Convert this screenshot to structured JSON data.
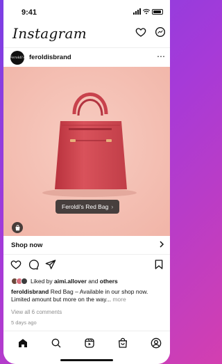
{
  "status": {
    "time": "9:41"
  },
  "header": {
    "logo": "Instagram"
  },
  "post": {
    "account": "feroldisbrand",
    "avatar_text": "Feroldi's",
    "product_tag": "Feroldi's Red Bag",
    "shop_now": "Shop now",
    "liked_by_prefix": "Liked by",
    "liked_by_user": "aimi.allover",
    "liked_by_and": "and",
    "liked_by_others": "others",
    "caption_user": "feroldisbrand",
    "caption_text": "Red Bag – Available in our shop now. Limited amount but more on the way...",
    "caption_more": "more",
    "view_comments": "View all 6 comments",
    "posted_time": "5 days ago"
  },
  "colors": {
    "media_bg": "#f4c1b5",
    "bag": "#d44a54",
    "frame_gradient_start": "#7b3fe4",
    "frame_gradient_end": "#d33fb0"
  },
  "icons": {
    "top": [
      "heart-icon",
      "messenger-icon"
    ],
    "actions": [
      "heart-icon",
      "comment-icon",
      "share-icon",
      "bookmark-icon"
    ],
    "tabs": [
      "home-icon",
      "search-icon",
      "reels-icon",
      "shop-icon",
      "profile-icon"
    ]
  }
}
